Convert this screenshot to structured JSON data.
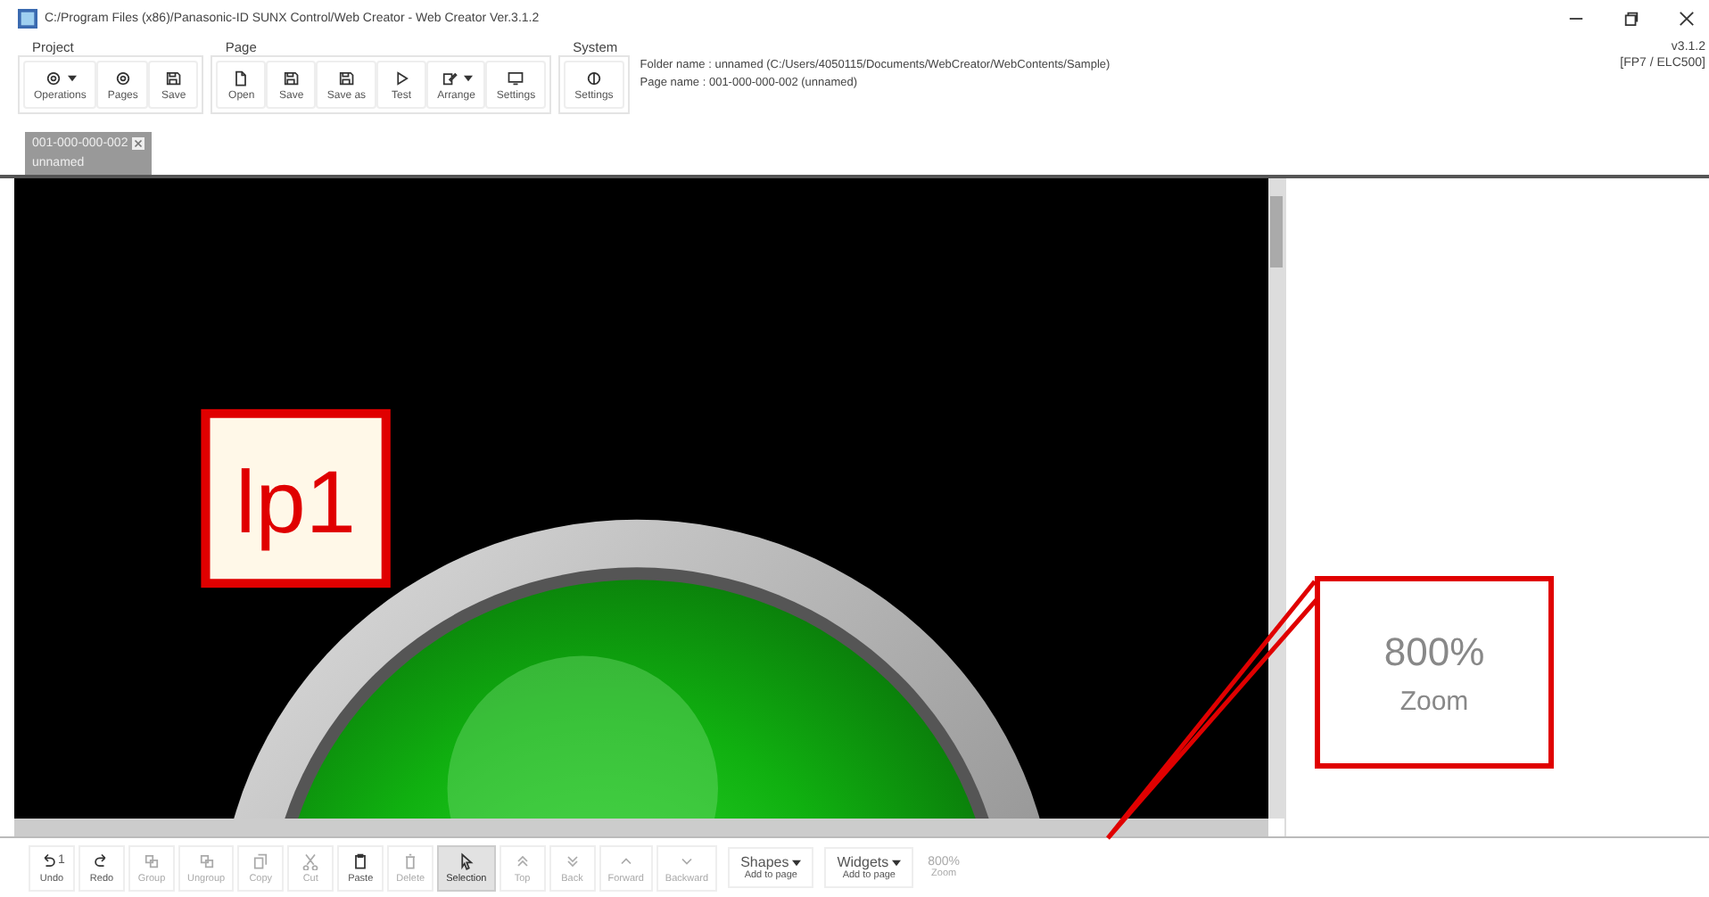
{
  "window": {
    "title": "C:/Program Files (x86)/Panasonic-ID SUNX Control/Web Creator - Web Creator Ver.3.1.2",
    "version": "v3.1.2",
    "plc": "[FP7 / ELC500]"
  },
  "ribbon": [
    {
      "group": "Project",
      "buttons": [
        {
          "label": "Operations",
          "kind": "gear",
          "dropdown": true
        },
        {
          "label": "Pages",
          "kind": "gear",
          "dropdown": false
        },
        {
          "label": "Save",
          "kind": "disk",
          "dropdown": false
        }
      ]
    },
    {
      "group": "Page",
      "buttons": [
        {
          "label": "Open",
          "kind": "page",
          "dropdown": false
        },
        {
          "label": "Save",
          "kind": "disk",
          "dropdown": false
        },
        {
          "label": "Save as",
          "kind": "disk",
          "dropdown": false
        },
        {
          "label": "Test",
          "kind": "play",
          "dropdown": false
        },
        {
          "label": "Arrange",
          "kind": "edit",
          "dropdown": true
        },
        {
          "label": "Settings",
          "kind": "monitor",
          "dropdown": false
        }
      ]
    },
    {
      "group": "System",
      "buttons": [
        {
          "label": "Settings",
          "kind": "contrast",
          "dropdown": false
        }
      ]
    }
  ],
  "info": {
    "folder": "Folder name : unnamed (C:/Users/4050115/Documents/WebCreator/WebContents/Sample)",
    "page": "Page name  : 001-000-000-002 (unnamed)"
  },
  "page_tab": {
    "id": "001-000-000-002",
    "name": "unnamed",
    "selected": true
  },
  "canvas": {
    "label": "lp1"
  },
  "toolbar": [
    {
      "label": "Undo",
      "kind": "undo",
      "count": "1",
      "selected": false,
      "disabled": false
    },
    {
      "label": "Redo",
      "kind": "redo",
      "selected": false,
      "disabled": false
    },
    {
      "label": "Group",
      "kind": "group",
      "selected": false,
      "disabled": true
    },
    {
      "label": "Ungroup",
      "kind": "group",
      "selected": false,
      "disabled": true
    },
    {
      "label": "Copy",
      "kind": "copy",
      "selected": false,
      "disabled": true
    },
    {
      "label": "Cut",
      "kind": "cut",
      "selected": false,
      "disabled": true
    },
    {
      "label": "Paste",
      "kind": "paste",
      "selected": false,
      "disabled": false
    },
    {
      "label": "Delete",
      "kind": "trash",
      "selected": false,
      "disabled": true
    },
    {
      "label": "Selection",
      "kind": "pointer",
      "selected": true,
      "disabled": false
    },
    {
      "label": "Top",
      "kind": "up2",
      "selected": false,
      "disabled": true
    },
    {
      "label": "Back",
      "kind": "down2",
      "selected": false,
      "disabled": true
    },
    {
      "label": "Forward",
      "kind": "up",
      "selected": false,
      "disabled": true
    },
    {
      "label": "Backward",
      "kind": "down",
      "selected": false,
      "disabled": true
    }
  ],
  "add_menus": [
    {
      "label": "Shapes",
      "caption": "Add to page"
    },
    {
      "label": "Widgets",
      "caption": "Add to page"
    }
  ],
  "zoom": {
    "value": "800%",
    "caption": "Zoom"
  },
  "callout": {
    "value": "800%",
    "caption": "Zoom"
  }
}
